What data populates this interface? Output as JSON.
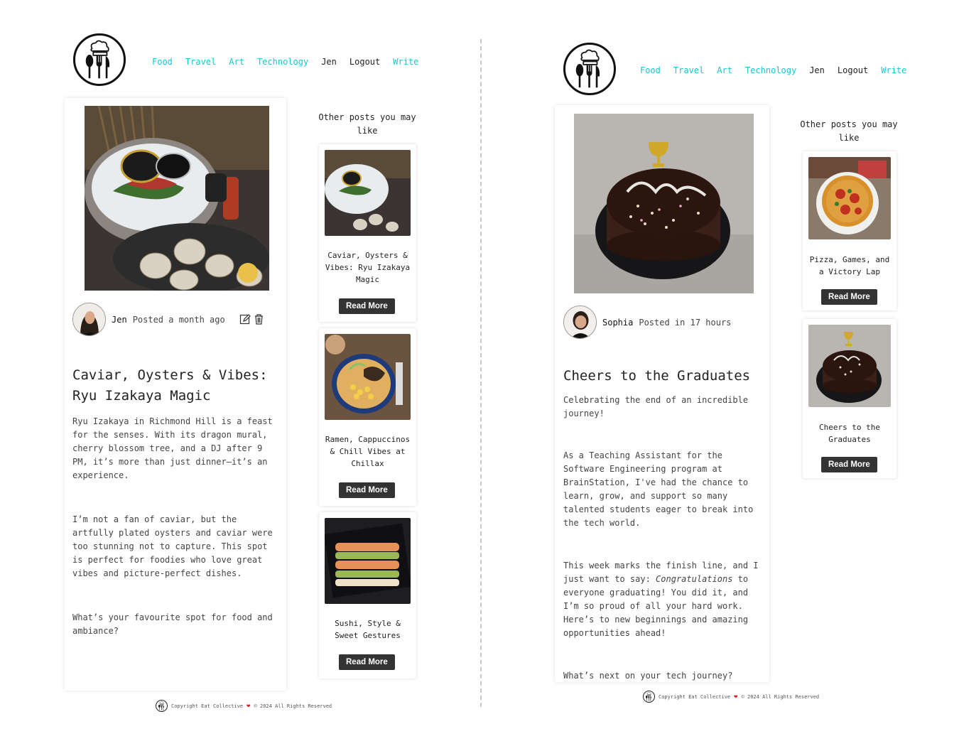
{
  "nav": {
    "items": [
      {
        "label": "Food"
      },
      {
        "label": "Travel"
      },
      {
        "label": "Art"
      },
      {
        "label": "Technology"
      },
      {
        "label": "Jen"
      },
      {
        "label": "Logout"
      },
      {
        "label": "Write"
      }
    ],
    "accent_color": "#19c7d0"
  },
  "left": {
    "post": {
      "author": "Jen",
      "posted": "Posted a month ago",
      "title": "Caviar, Oysters & Vibes: Ryu Izakaya Magic",
      "paragraphs": [
        "Ryu Izakaya in Richmond Hill is a feast for the senses. With its dragon mural, cherry blossom tree, and a DJ after 9 PM, it’s more than just dinner—it’s an experience.",
        "I’m not a fan of caviar, but the artfully plated oysters and caviar were too stunning not to capture. This spot is perfect for foodies who love great vibes and picture-perfect dishes.",
        "What’s your favourite spot for food and ambiance?"
      ]
    },
    "sidebar": {
      "heading": "Other posts you may like",
      "cards": [
        {
          "title": "Caviar, Oysters & Vibes: Ryu Izakaya Magic",
          "button": "Read More"
        },
        {
          "title": "Ramen, Cappuccinos & Chill Vibes at Chillax",
          "button": "Read More"
        },
        {
          "title": "Sushi, Style & Sweet Gestures",
          "button": "Read More"
        }
      ]
    },
    "footer": {
      "left": "Copyright Eat Collective",
      "right": "© 2024 All Rights Reserved"
    }
  },
  "right": {
    "post": {
      "author": "Sophia",
      "posted": "Posted in 17 hours",
      "title": "Cheers to the Graduates",
      "p1": "Celebrating the end of an incredible journey!",
      "p2": "As a Teaching Assistant for the Software Engineering program at BrainStation, I've had the chance to learn, grow, and support so many talented students eager to break into the tech world.",
      "p3_before": "This week marks the finish line, and I just want to say: ",
      "p3_em": "Congratulations",
      "p3_after": " to everyone graduating! You did it, and I’m so proud of all your hard work. Here’s to new beginnings and amazing opportunities ahead!",
      "p4": "What’s next on your tech journey?"
    },
    "sidebar": {
      "heading": "Other posts you may like",
      "cards": [
        {
          "title": "Pizza, Games, and a Victory Lap",
          "button": "Read More"
        },
        {
          "title": "Cheers to the Graduates",
          "button": "Read More"
        }
      ]
    },
    "footer": {
      "left": "Copyright Eat Collective",
      "right": "© 2024 All Rights Reserved"
    }
  }
}
